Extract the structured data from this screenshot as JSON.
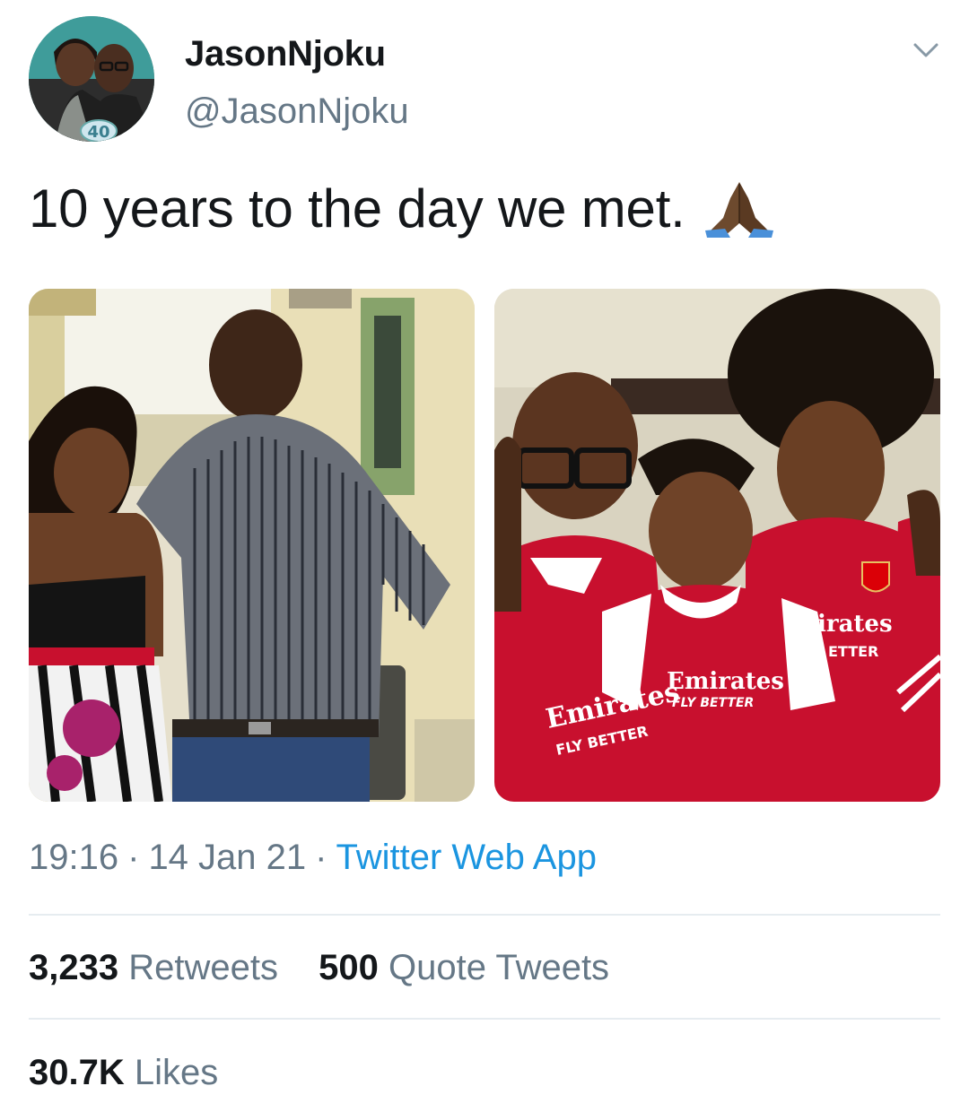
{
  "user": {
    "display_name": "JasonNjoku",
    "handle": "@JasonNjoku",
    "avatar_badge": "40"
  },
  "tweet": {
    "text": "10 years to the day we met."
  },
  "images": {
    "right_jersey_left": "Emirates",
    "right_jersey_left_sub": "FLY BETTER",
    "right_jersey_center": "Emirates",
    "right_jersey_center_sub": "FLY BETTER",
    "right_jersey_right": "irates",
    "right_jersey_right_sub": "ETTER"
  },
  "meta": {
    "time": "19:16",
    "date": "14 Jan 21",
    "separator": "·",
    "source": "Twitter Web App"
  },
  "stats": {
    "retweets_count": "3,233",
    "retweets_label": "Retweets",
    "quotes_count": "500",
    "quotes_label": "Quote Tweets",
    "likes_count": "30.7K",
    "likes_label": "Likes"
  },
  "colors": {
    "link": "#1b95e0",
    "secondary_text": "#657786",
    "divider": "#e6ecf0",
    "arsenal_red": "#c8102e"
  },
  "icons": [
    "chevron-down-icon",
    "folded-hands-emoji"
  ]
}
